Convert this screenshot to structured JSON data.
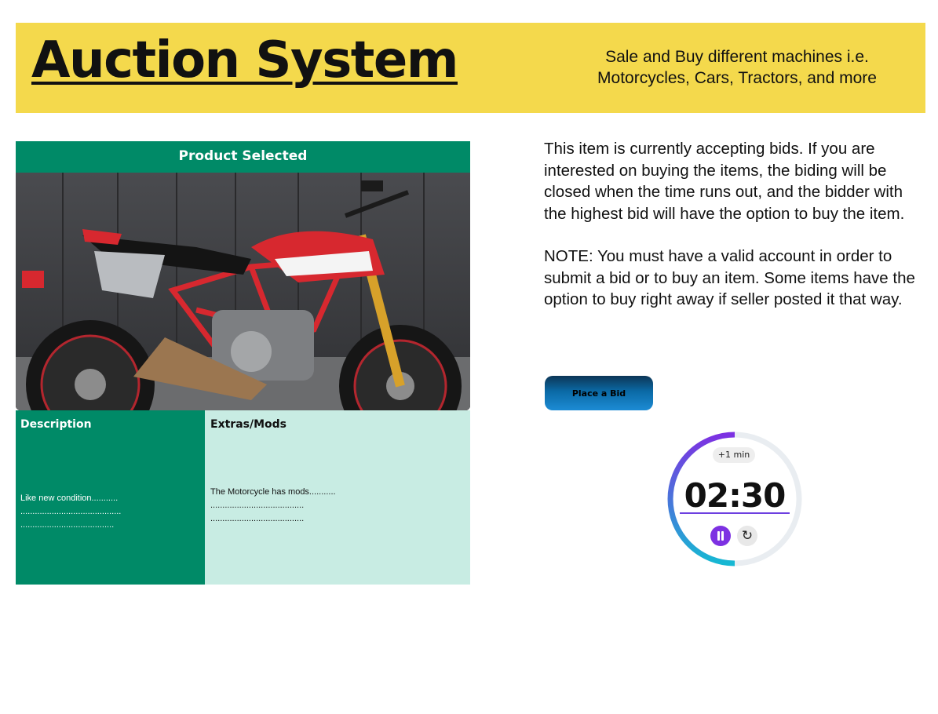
{
  "header": {
    "title": "Auction System",
    "tagline": "Sale and Buy different machines i.e. Motorcycles, Cars, Tractors, and more"
  },
  "product": {
    "band_label": "Product Selected",
    "image": "motorcycle-photo",
    "description": {
      "heading": "Description",
      "text": "Like new condition...........\n..........................................\n......................................."
    },
    "extras": {
      "heading": "Extras/Mods",
      "text": "The Motorcycle has mods...........\n.......................................\n......................................."
    }
  },
  "info": {
    "paragraph1": "This item is currently accepting bids. If you are interested on buying the items, the biding will be closed when the time runs out, and the bidder with the highest bid will have the option to buy the item.",
    "paragraph2": "NOTE: You must have a valid account in order to submit a bid or to buy an item. Some items have the option to buy right away if seller posted it that way."
  },
  "bid_button": {
    "label": "Place a Bid"
  },
  "timer": {
    "add_minute_label": "+1 min",
    "time": "02:30",
    "progress": 0.5,
    "pause_icon": "pause-icon",
    "reset_icon": "reset-icon",
    "colors": {
      "ring_start": "#7d31e2",
      "ring_end": "#16b8d3",
      "track": "#e9edf1"
    }
  },
  "colors": {
    "header_bg": "#f4d94c",
    "green": "#008a67",
    "mint": "#c8ece3",
    "button_blue": "#0b6aa6"
  }
}
